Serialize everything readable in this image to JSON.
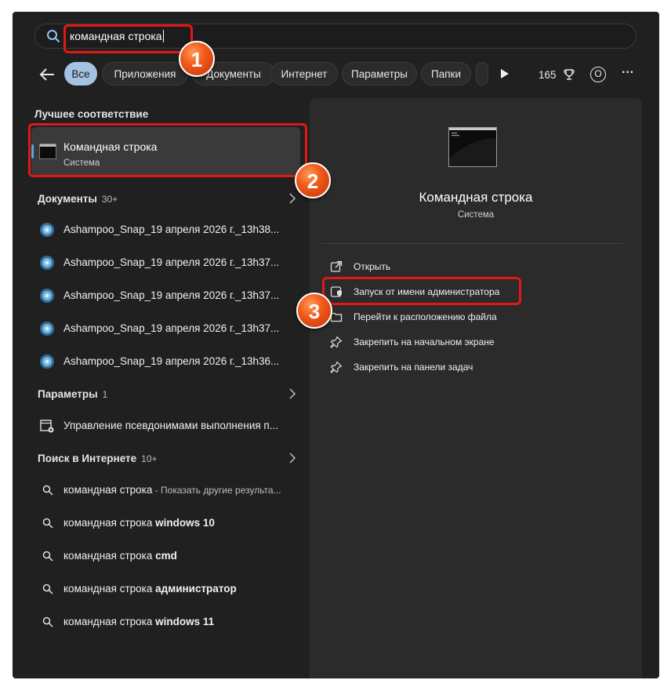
{
  "search": {
    "value": "командная строка"
  },
  "filters": {
    "tabs": [
      "Все",
      "Приложения",
      "Документы",
      "Интернет",
      "Параметры",
      "Папки"
    ],
    "points": "165",
    "avatar": "O",
    "more": "···"
  },
  "best_match": {
    "header": "Лучшее соответствие",
    "title": "Командная строка",
    "subtitle": "Система"
  },
  "documents": {
    "header": "Документы",
    "count": "30+",
    "items": [
      "Ashampoo_Snap_19 апреля 2026 г._13h38...",
      "Ashampoo_Snap_19 апреля 2026 г._13h37...",
      "Ashampoo_Snap_19 апреля 2026 г._13h37...",
      "Ashampoo_Snap_19 апреля 2026 г._13h37...",
      "Ashampoo_Snap_19 апреля 2026 г._13h36..."
    ]
  },
  "settings": {
    "header": "Параметры",
    "count": "1",
    "items": [
      "Управление псевдонимами выполнения п..."
    ]
  },
  "web": {
    "header": "Поиск в Интернете",
    "count": "10+",
    "items": [
      {
        "query": "командная строка",
        "suffix": " - Показать другие результа..."
      },
      {
        "query": "командная строка",
        "suffix": " windows 10"
      },
      {
        "query": "командная строка",
        "suffix": " cmd"
      },
      {
        "query": "командная строка",
        "suffix": " администратор"
      },
      {
        "query": "командная строка",
        "suffix": " windows 11"
      }
    ]
  },
  "detail": {
    "title": "Командная строка",
    "subtitle": "Система",
    "actions": [
      "Открыть",
      "Запуск от имени администратора",
      "Перейти к расположению файла",
      "Закрепить на начальном экране",
      "Закрепить на панели задач"
    ]
  },
  "annotations": [
    "1",
    "2",
    "3"
  ],
  "colors": {
    "accent": "#a4c2e1",
    "highlight": "#e01818",
    "badge": "#f05a18"
  }
}
